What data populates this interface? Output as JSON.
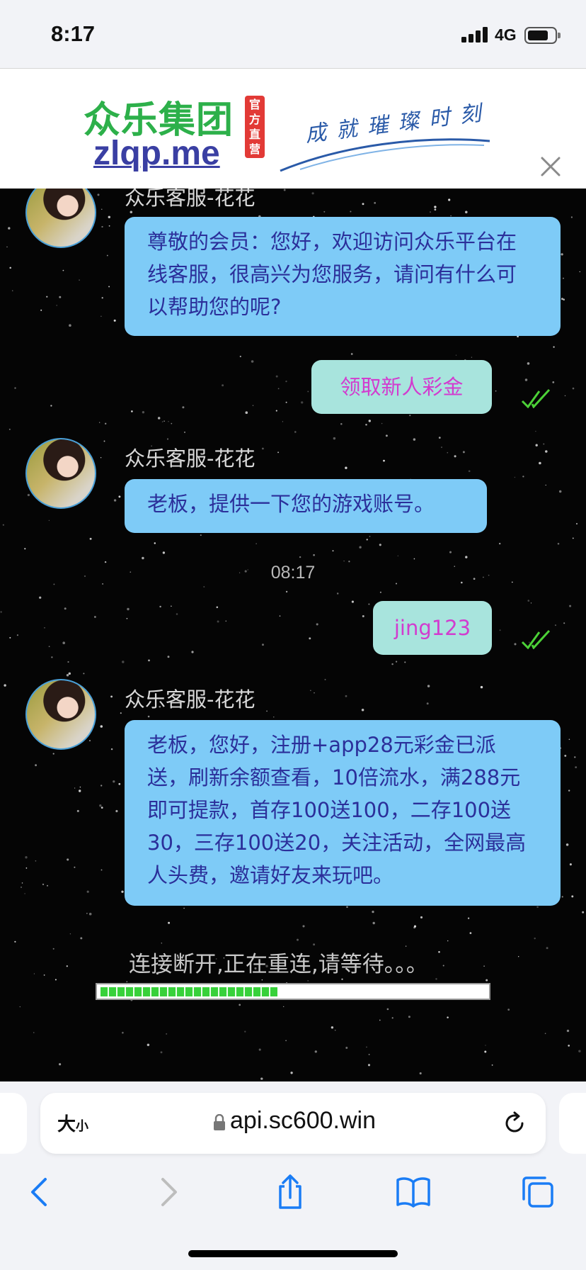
{
  "status_bar": {
    "time": "8:17",
    "network": "4G"
  },
  "banner": {
    "logo_cn": "众乐集团",
    "logo_en": "zlqp.me",
    "official_badge": "官方直营",
    "slogan": "成就璀璨时刻"
  },
  "chat": {
    "messages": [
      {
        "sender": "众乐客服-花花",
        "text": "尊敬的会员：您好，欢迎访问众乐平台在线客服，很高兴为您服务，请问有什么可以帮助您的呢?"
      },
      {
        "outgoing": "领取新人彩金"
      },
      {
        "sender": "众乐客服-花花",
        "text": "老板，提供一下您的游戏账号。"
      },
      {
        "timestamp": "08:17"
      },
      {
        "outgoing": "jing123"
      },
      {
        "sender": "众乐客服-花花",
        "text": "老板，您好，注册+app28元彩金已派送，刷新余额查看，10倍流水，满288元即可提款，首存100送100，二存100送30，三存100送20，关注活动，全网最高人头费，邀请好友来玩吧。"
      }
    ],
    "reconnect_text": "连接断开,正在重连,请等待。。。",
    "reconnect_progress": 0.46
  },
  "safari": {
    "text_size_label": "大",
    "text_size_small": "小",
    "url": "api.sc600.win"
  },
  "icons": [
    "close-icon",
    "check-icon",
    "lock-icon",
    "reload-icon",
    "back-icon",
    "forward-icon",
    "share-icon",
    "bookmarks-icon",
    "tabs-icon"
  ],
  "colors": {
    "incoming_bubble": "#7ecbf7",
    "outgoing_bubble": "#a8e4dd",
    "outgoing_text": "#d23ccf",
    "incoming_text": "#2b2f9a",
    "check": "#4cd137"
  }
}
